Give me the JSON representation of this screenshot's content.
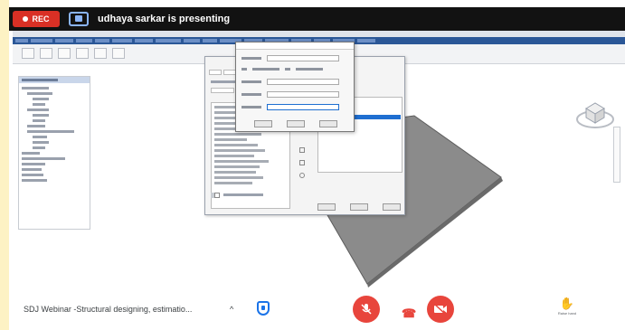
{
  "banner": {
    "rec_label": "REC",
    "presenting_text": "udhaya sarkar is presenting"
  },
  "bottom": {
    "meeting_title": "SDJ Webinar -Structural designing, estimatio...",
    "chevron": "^",
    "raise_hand_label": "Raise hand"
  },
  "colors": {
    "rec": "#d93025",
    "end_call": "#e8453c",
    "accent_blue": "#1a73e8",
    "side_strip": "#fdf2c4"
  },
  "icons": [
    "record-dot-icon",
    "presentation-icon",
    "shield-icon",
    "mic-off-icon",
    "end-call-icon",
    "camera-off-icon",
    "raise-hand-icon"
  ]
}
